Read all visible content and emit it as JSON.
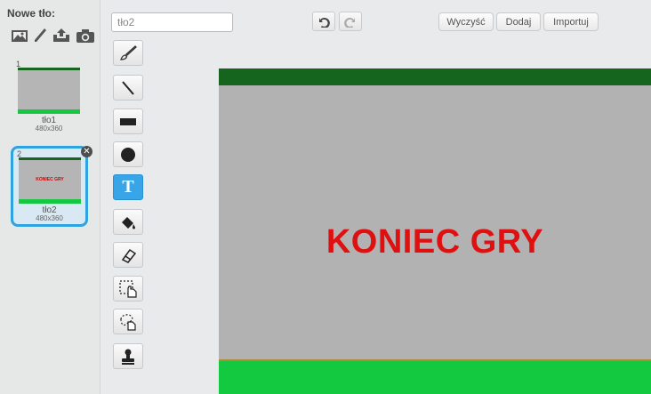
{
  "left_panel": {
    "new_backdrop_label": "Nowe tło:",
    "new_tools": [
      "choose-from-library-icon",
      "paint-new-icon",
      "upload-icon",
      "camera-icon"
    ],
    "backdrops": [
      {
        "index": "1",
        "name": "tło1",
        "size": "480x360",
        "thumb_text": ""
      },
      {
        "index": "2",
        "name": "tło2",
        "size": "480x360",
        "thumb_text": "KONIEC GRY",
        "selected": true
      }
    ],
    "delete_icon": "close-icon"
  },
  "editor": {
    "name_value": "tło2",
    "history": {
      "undo_icon": "undo-icon",
      "redo_icon": "redo-icon"
    },
    "buttons": {
      "clear": "Wyczyść",
      "add": "Dodaj",
      "import": "Importuj"
    },
    "tools": [
      "brush-icon",
      "line-icon",
      "rectangle-icon",
      "ellipse-icon",
      "text-icon",
      "fill-icon",
      "eraser-icon",
      "select-icon",
      "reshape-select-icon",
      "stamp-icon"
    ],
    "text_tool_glyph": "T",
    "active_tool": "text-icon"
  },
  "canvas": {
    "text": "KONIEC GRY",
    "colors": {
      "background": "#b2b2b2",
      "top_band": "#16651e",
      "bottom_band": "#12c93f",
      "text": "#e01010"
    }
  },
  "colors": {
    "selection": "#2fa3e0",
    "active_tool": "#37a5e8"
  }
}
